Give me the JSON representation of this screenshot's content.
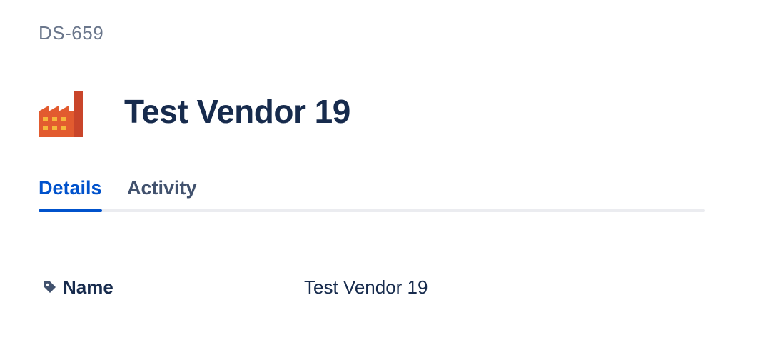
{
  "issue": {
    "key": "DS-659",
    "title": "Test Vendor 19",
    "icon": "factory-icon"
  },
  "tabs": [
    {
      "label": "Details",
      "active": true
    },
    {
      "label": "Activity",
      "active": false
    }
  ],
  "fields": [
    {
      "label": "Name",
      "icon": "tag-icon",
      "value": "Test Vendor 19"
    }
  ],
  "colors": {
    "accent": "#0052cc",
    "title": "#172b4d",
    "muted": "#6b778c",
    "factory": "#d9562b"
  }
}
